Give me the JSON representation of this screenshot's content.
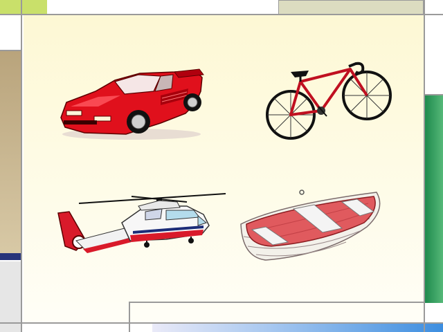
{
  "slide": {
    "pictures": [
      {
        "name": "sports-car",
        "icon": "red-sports-car"
      },
      {
        "name": "bicycle",
        "icon": "red-road-bicycle"
      },
      {
        "name": "helicopter",
        "icon": "red-white-helicopter"
      },
      {
        "name": "rowboat",
        "icon": "red-rowing-boat"
      }
    ]
  },
  "colors": {
    "background": "#fdf8d4",
    "accent_green": "#c9e06a",
    "accent_olive": "#dcdcc0",
    "accent_tan": "#c8b48e",
    "accent_navy": "#27337a",
    "accent_emerald": "#2f9a5c",
    "accent_blue": "#5a9fe0"
  }
}
